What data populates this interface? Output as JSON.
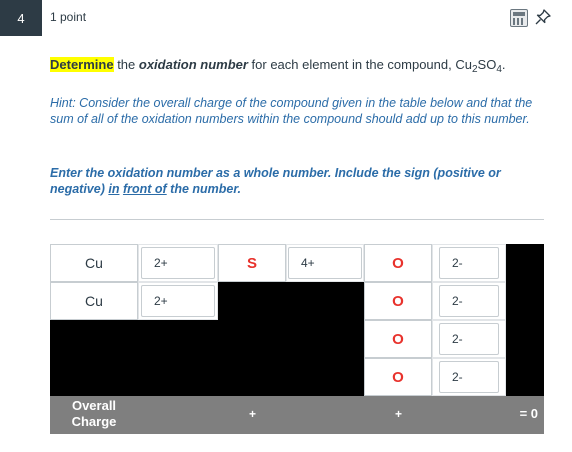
{
  "question": {
    "number": "4",
    "points": "1 point"
  },
  "toolbar": {
    "calculator_icon": "calculator-icon",
    "pin_icon": "pin-icon"
  },
  "prompt": {
    "determine": "Determine",
    "rest1": " the ",
    "oxidation": "oxidation number",
    "rest2": " for each element in the compound, Cu",
    "sub2": "2",
    "so": "SO",
    "sub4": "4",
    "dot": "."
  },
  "hint": "Hint: Consider the overall charge of the compound given in the table below and that the sum of all of the oxidation numbers within the compound should add up to this number.",
  "enter": {
    "part1": "Enter the oxidation number as a whole number. Include the sign (positive or negative) ",
    "link1": "in",
    "space": " ",
    "link2": "front of",
    "part2": " the number."
  },
  "table": {
    "rows": [
      {
        "el1": "Cu",
        "v1": "2+",
        "el2": "S",
        "v2": "4+",
        "el3": "O",
        "v3": "2-"
      },
      {
        "el1": "Cu",
        "v1": "2+",
        "el3": "O",
        "v3": "2-"
      },
      {
        "el3": "O",
        "v3": "2-"
      },
      {
        "el3": "O",
        "v3": "2-"
      }
    ],
    "footer": {
      "label_line1": "Overall",
      "label_line2": "Charge",
      "plus1": "+",
      "plus2": "+",
      "total": "= 0"
    }
  },
  "colors": {
    "element_red": "#e8322c",
    "hint_blue": "#2b6ca8",
    "highlight": "#ffff00"
  }
}
